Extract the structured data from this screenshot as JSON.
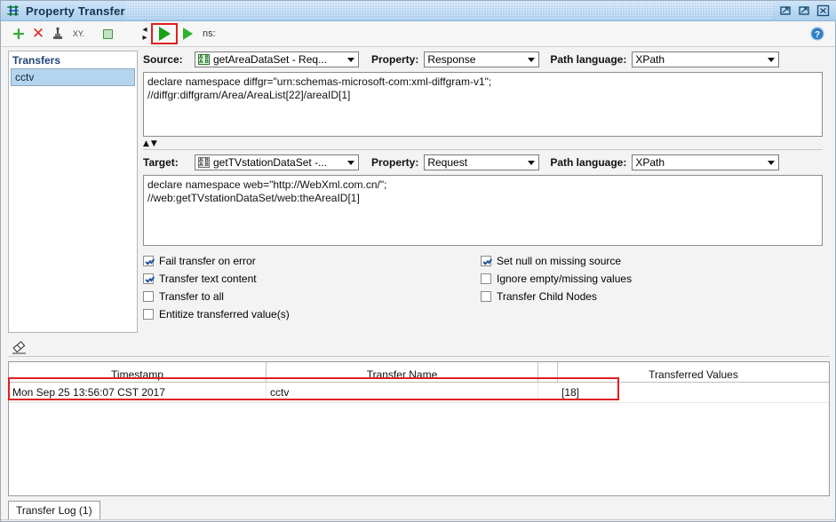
{
  "window": {
    "title": "Property Transfer",
    "icon": "property-transfer-icon",
    "buttons": [
      {
        "name": "minimize-button",
        "glyph": "minimize"
      },
      {
        "name": "maximize-button",
        "glyph": "maximize"
      },
      {
        "name": "close-button",
        "glyph": "close"
      }
    ]
  },
  "toolbar": {
    "add_label": "+",
    "delete_label": "✕",
    "stamp_icon": "stamp-icon",
    "xy_label": "XY.",
    "dot_icon": "green-square-icon",
    "run_label": "run-transfer",
    "run_all_label": "run-all-transfers",
    "ns_label": "ns:",
    "help_label": "?"
  },
  "transfers_panel": {
    "header": "Transfers",
    "items": [
      {
        "label": "cctv",
        "selected": true
      }
    ]
  },
  "source": {
    "label": "Source:",
    "step": "getAreaDataSet - Req...",
    "property_label": "Property:",
    "property": "Response",
    "path_language_label": "Path language:",
    "path_language": "XPath",
    "expression": "declare namespace diffgr=\"urn:schemas-microsoft-com:xml-diffgram-v1\";\n//diffgr:diffgram/Area/AreaList[22]/areaID[1]"
  },
  "target": {
    "label": "Target:",
    "step": "getTVstationDataSet -...",
    "property_label": "Property:",
    "property": "Request",
    "path_language_label": "Path language:",
    "path_language": "XPath",
    "expression": "declare namespace web=\"http://WebXml.com.cn/\";\n//web:getTVstationDataSet/web:theAreaID[1]"
  },
  "options": {
    "left": [
      {
        "label": "Fail transfer on error",
        "checked": true
      },
      {
        "label": "Transfer text content",
        "checked": true
      },
      {
        "label": "Transfer to all",
        "checked": false
      },
      {
        "label": "Entitize transferred value(s)",
        "checked": false
      }
    ],
    "right": [
      {
        "label": "Set null on missing source",
        "checked": true
      },
      {
        "label": "Ignore empty/missing values",
        "checked": false
      },
      {
        "label": "Transfer Child Nodes",
        "checked": false
      }
    ]
  },
  "log": {
    "clear_icon": "eraser-icon",
    "columns": [
      "Timestamp",
      "Transfer Name",
      "",
      "Transferred Values"
    ],
    "rows": [
      {
        "timestamp": "Mon Sep 25 13:56:07 CST 2017",
        "transfer_name": "cctv",
        "values": "[18]",
        "transferred_values": "",
        "highlighted": true
      }
    ]
  },
  "tabs": [
    {
      "label": "Transfer Log (1)",
      "active": true
    }
  ],
  "colors": {
    "title_start": "#cfe4f7",
    "title_end": "#aacdec",
    "accent_green": "#16a016",
    "accent_red": "#e02020",
    "selection_blue": "#b5d5ef",
    "header_text": "#21457a"
  }
}
